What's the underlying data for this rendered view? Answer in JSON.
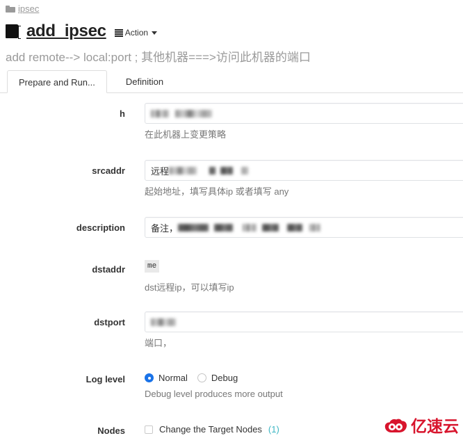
{
  "breadcrumb": {
    "icon": "folder-icon",
    "label": "ipsec"
  },
  "header": {
    "icon": "book-icon",
    "title": "add_ipsec",
    "action_menu": {
      "icon": "list-icon",
      "label": "Action",
      "caret": "chevron-down-icon"
    }
  },
  "subtitle": "add remote--> local:port ; 其他机器===>访问此机器的端口",
  "tabs": [
    {
      "label": "Prepare and Run...",
      "active": true
    },
    {
      "label": "Definition",
      "active": false
    }
  ],
  "form": {
    "fields": [
      {
        "label": "h",
        "type": "text",
        "value": "",
        "redacted": true,
        "help": "在此机器上变更策略"
      },
      {
        "label": "srcaddr",
        "type": "text",
        "value": "远程",
        "redacted": true,
        "help": "起始地址，填写具体ip       或者填写 any"
      },
      {
        "label": "description",
        "type": "text",
        "value": "备注，",
        "redacted": true,
        "help": ""
      },
      {
        "label": "dstaddr",
        "type": "static",
        "value": "me",
        "help": "dst远程ip，可以填写ip"
      },
      {
        "label": "dstport",
        "type": "text",
        "value": "",
        "redacted": true,
        "help": "端口，"
      },
      {
        "label": "Log level",
        "type": "radio",
        "options": [
          {
            "label": "Normal",
            "checked": true
          },
          {
            "label": "Debug",
            "checked": false
          }
        ],
        "help": "Debug level produces more output"
      },
      {
        "label": "Nodes",
        "type": "checkbox",
        "checkbox_label": "Change the Target Nodes",
        "checkbox_count": "(1)",
        "checked": false
      }
    ]
  },
  "watermark": {
    "icon": "cloud-logo-icon",
    "text": "亿速云"
  },
  "colors": {
    "accent_blue": "#1a73e8",
    "link_teal": "#3cb6c3",
    "muted": "#9a9a9a",
    "brand_red": "#d8152d"
  }
}
